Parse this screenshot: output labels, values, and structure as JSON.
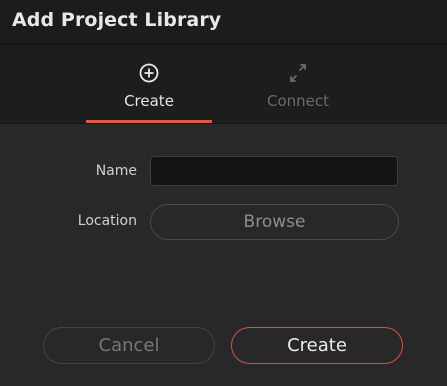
{
  "dialog": {
    "title": "Add Project Library"
  },
  "tabs": [
    {
      "label": "Create",
      "icon": "plus-circle-icon",
      "active": true
    },
    {
      "label": "Connect",
      "icon": "swap-arrows-icon",
      "active": false
    }
  ],
  "form": {
    "name_label": "Name",
    "name_value": "",
    "location_label": "Location",
    "browse_label": "Browse"
  },
  "footer": {
    "cancel_label": "Cancel",
    "create_label": "Create"
  },
  "colors": {
    "accent": "#e05a43",
    "background": "#28282a",
    "header_background": "#1c1c1e"
  }
}
